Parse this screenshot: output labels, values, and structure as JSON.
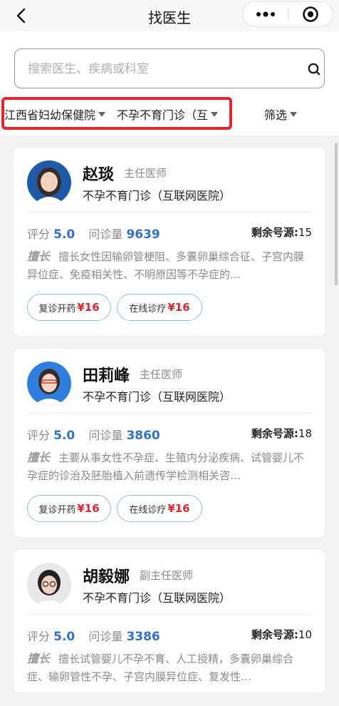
{
  "nav": {
    "title": "找医生"
  },
  "search": {
    "placeholder": "搜索医生、疾病或科室"
  },
  "filters": {
    "hospital": "江西省妇幼保健院",
    "department": "不孕不育门诊（互",
    "screen": "筛选"
  },
  "stat_labels": {
    "rating": "评分",
    "consult": "问诊量",
    "remaining": "剩余号源:"
  },
  "specialty_tag": "擅长",
  "doctors": [
    {
      "name": "赵琰",
      "title": "主任医师",
      "dept": "不孕不育门诊（互联网医院）",
      "rating": "5.0",
      "consults": "9639",
      "remaining": "15",
      "specialty": "擅长女性因输卵管梗阻、多囊卵巢综合征、子宫内膜异位症、免疫相关性、不明原因等不孕症的…",
      "btn1_label": "复诊开药",
      "btn1_price": "¥16",
      "btn2_label": "在线诊疗",
      "btn2_price": "¥16"
    },
    {
      "name": "田莉峰",
      "title": "主任医师",
      "dept": "不孕不育门诊（互联网医院）",
      "rating": "5.0",
      "consults": "3860",
      "remaining": "18",
      "specialty": "主要从事女性不孕症、生殖内分泌疾病、试管婴儿不孕症的诊治及胚胎植入前遗传学检测相关咨…",
      "btn1_label": "复诊开药",
      "btn1_price": "¥16",
      "btn2_label": "在线诊疗",
      "btn2_price": "¥16"
    },
    {
      "name": "胡毅娜",
      "title": "副主任医师",
      "dept": "不孕不育门诊（互联网医院）",
      "rating": "5.0",
      "consults": "3386",
      "remaining": "10",
      "specialty": "擅长试管婴儿不孕不育、人工授精，多囊卵巢综合症、输卵管性不孕、子宫内膜异位症、复发性…"
    }
  ],
  "colors": {
    "accent_blue": "#2f6fd6",
    "price_red": "#e8232c",
    "highlight_red": "#e8232c"
  },
  "icons": [
    "back-icon",
    "more-icon",
    "target-icon",
    "search-icon",
    "caret-down-icon"
  ]
}
